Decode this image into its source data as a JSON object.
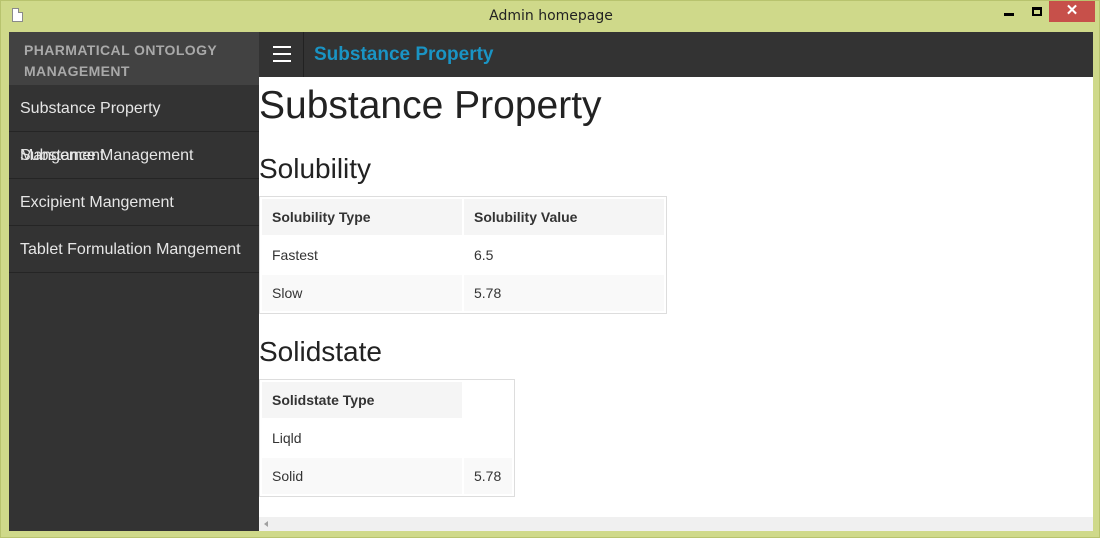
{
  "window": {
    "title": "Admin homepage",
    "close_glyph": "✕"
  },
  "sidebar": {
    "brand_line1": "PHARMATICAL ONTOLOGY",
    "brand_line2": "MANAGEMENT",
    "items": [
      {
        "label": "Substance Property Mangement"
      },
      {
        "label": "Substance Management"
      },
      {
        "label": "Excipient Mangement"
      },
      {
        "label": "Tablet Formulation Mangement"
      }
    ]
  },
  "topbar": {
    "title": "Substance Property"
  },
  "main": {
    "page_title": "Substance Property",
    "solubility": {
      "title": "Solubility",
      "headers": [
        "Solubility Type",
        "Solubility Value"
      ],
      "rows": [
        [
          "Fastest",
          "6.5"
        ],
        [
          "Slow",
          "5.78"
        ]
      ]
    },
    "solidstate": {
      "title": "Solidstate",
      "headers": [
        "Solidstate Type",
        ""
      ],
      "rows": [
        [
          "Liqld",
          ""
        ],
        [
          "Solid",
          "5.78"
        ]
      ]
    }
  },
  "colors": {
    "accent": "#1a94c4",
    "sidebar_bg": "#333333",
    "frame": "#cfd98a",
    "close_button": "#c7504a"
  }
}
